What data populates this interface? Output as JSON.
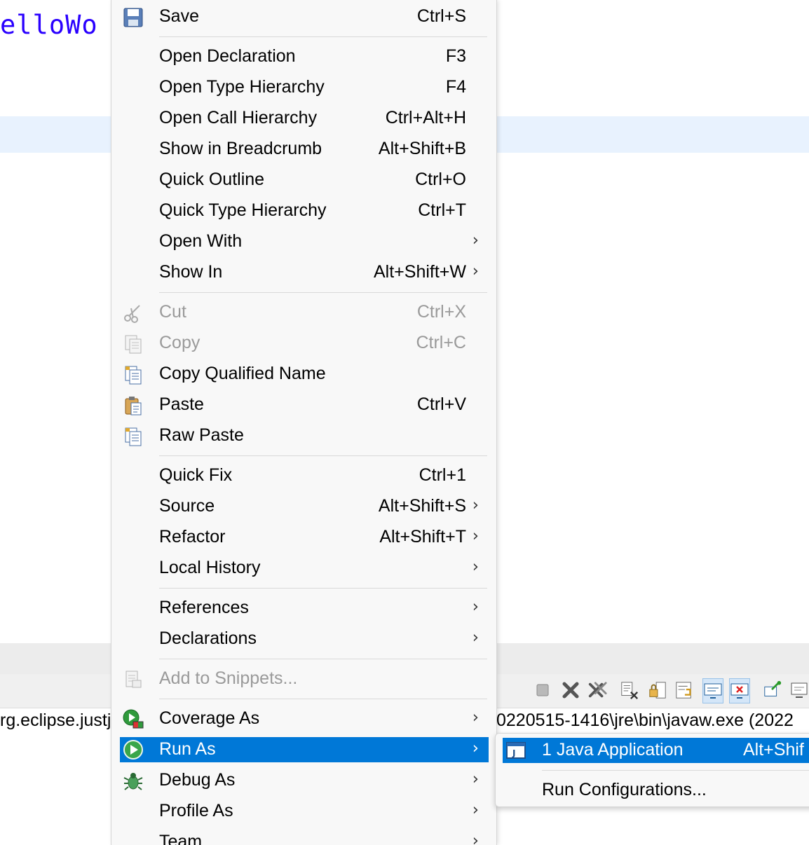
{
  "editor": {
    "code_fragment": "elloWo"
  },
  "console": {
    "left_text": "rg.eclipse.justj",
    "right_text": "0220515-1416\\jre\\bin\\javaw.exe  (2022"
  },
  "menu": {
    "items": [
      {
        "label": "Save",
        "shortcut": "Ctrl+S",
        "icon": "save-icon"
      },
      {
        "label": "Open Declaration",
        "shortcut": "F3"
      },
      {
        "label": "Open Type Hierarchy",
        "shortcut": "F4"
      },
      {
        "label": "Open Call Hierarchy",
        "shortcut": "Ctrl+Alt+H"
      },
      {
        "label": "Show in Breadcrumb",
        "shortcut": "Alt+Shift+B"
      },
      {
        "label": "Quick Outline",
        "shortcut": "Ctrl+O"
      },
      {
        "label": "Quick Type Hierarchy",
        "shortcut": "Ctrl+T"
      },
      {
        "label": "Open With",
        "shortcut": "",
        "submenu": true
      },
      {
        "label": "Show In",
        "shortcut": "Alt+Shift+W",
        "submenu": true
      },
      {
        "label": "Cut",
        "shortcut": "Ctrl+X",
        "icon": "scissors-icon",
        "disabled": true
      },
      {
        "label": "Copy",
        "shortcut": "Ctrl+C",
        "icon": "copy-icon",
        "disabled": true
      },
      {
        "label": "Copy Qualified Name",
        "shortcut": "",
        "icon": "copy-qualified-name-icon"
      },
      {
        "label": "Paste",
        "shortcut": "Ctrl+V",
        "icon": "paste-icon"
      },
      {
        "label": "Raw Paste",
        "shortcut": "",
        "icon": "raw-paste-icon"
      },
      {
        "label": "Quick Fix",
        "shortcut": "Ctrl+1"
      },
      {
        "label": "Source",
        "shortcut": "Alt+Shift+S",
        "submenu": true
      },
      {
        "label": "Refactor",
        "shortcut": "Alt+Shift+T",
        "submenu": true
      },
      {
        "label": "Local History",
        "shortcut": "",
        "submenu": true
      },
      {
        "label": "References",
        "shortcut": "",
        "submenu": true
      },
      {
        "label": "Declarations",
        "shortcut": "",
        "submenu": true
      },
      {
        "label": "Add to Snippets...",
        "shortcut": "",
        "icon": "snippets-icon",
        "disabled": true
      },
      {
        "label": "Coverage As",
        "shortcut": "",
        "icon": "coverage-icon",
        "submenu": true
      },
      {
        "label": "Run As",
        "shortcut": "",
        "icon": "run-icon",
        "submenu": true,
        "selected": true
      },
      {
        "label": "Debug As",
        "shortcut": "",
        "icon": "debug-bug-icon",
        "submenu": true
      },
      {
        "label": "Profile As",
        "shortcut": "",
        "submenu": true
      },
      {
        "label": "Team",
        "shortcut": "",
        "submenu": true
      }
    ],
    "submenu_arrow": "›"
  },
  "submenu": {
    "items": [
      {
        "label": "1 Java Application",
        "shortcut": "Alt+Shif",
        "icon": "java-application-icon",
        "selected": true
      },
      {
        "label": "Run Configurations...",
        "shortcut": ""
      }
    ]
  },
  "colors": {
    "selection": "#0078d7",
    "menu_background": "#f8f8f8",
    "editor_string": "#2a00ff",
    "editor_highlight": "#e8f2fe"
  }
}
